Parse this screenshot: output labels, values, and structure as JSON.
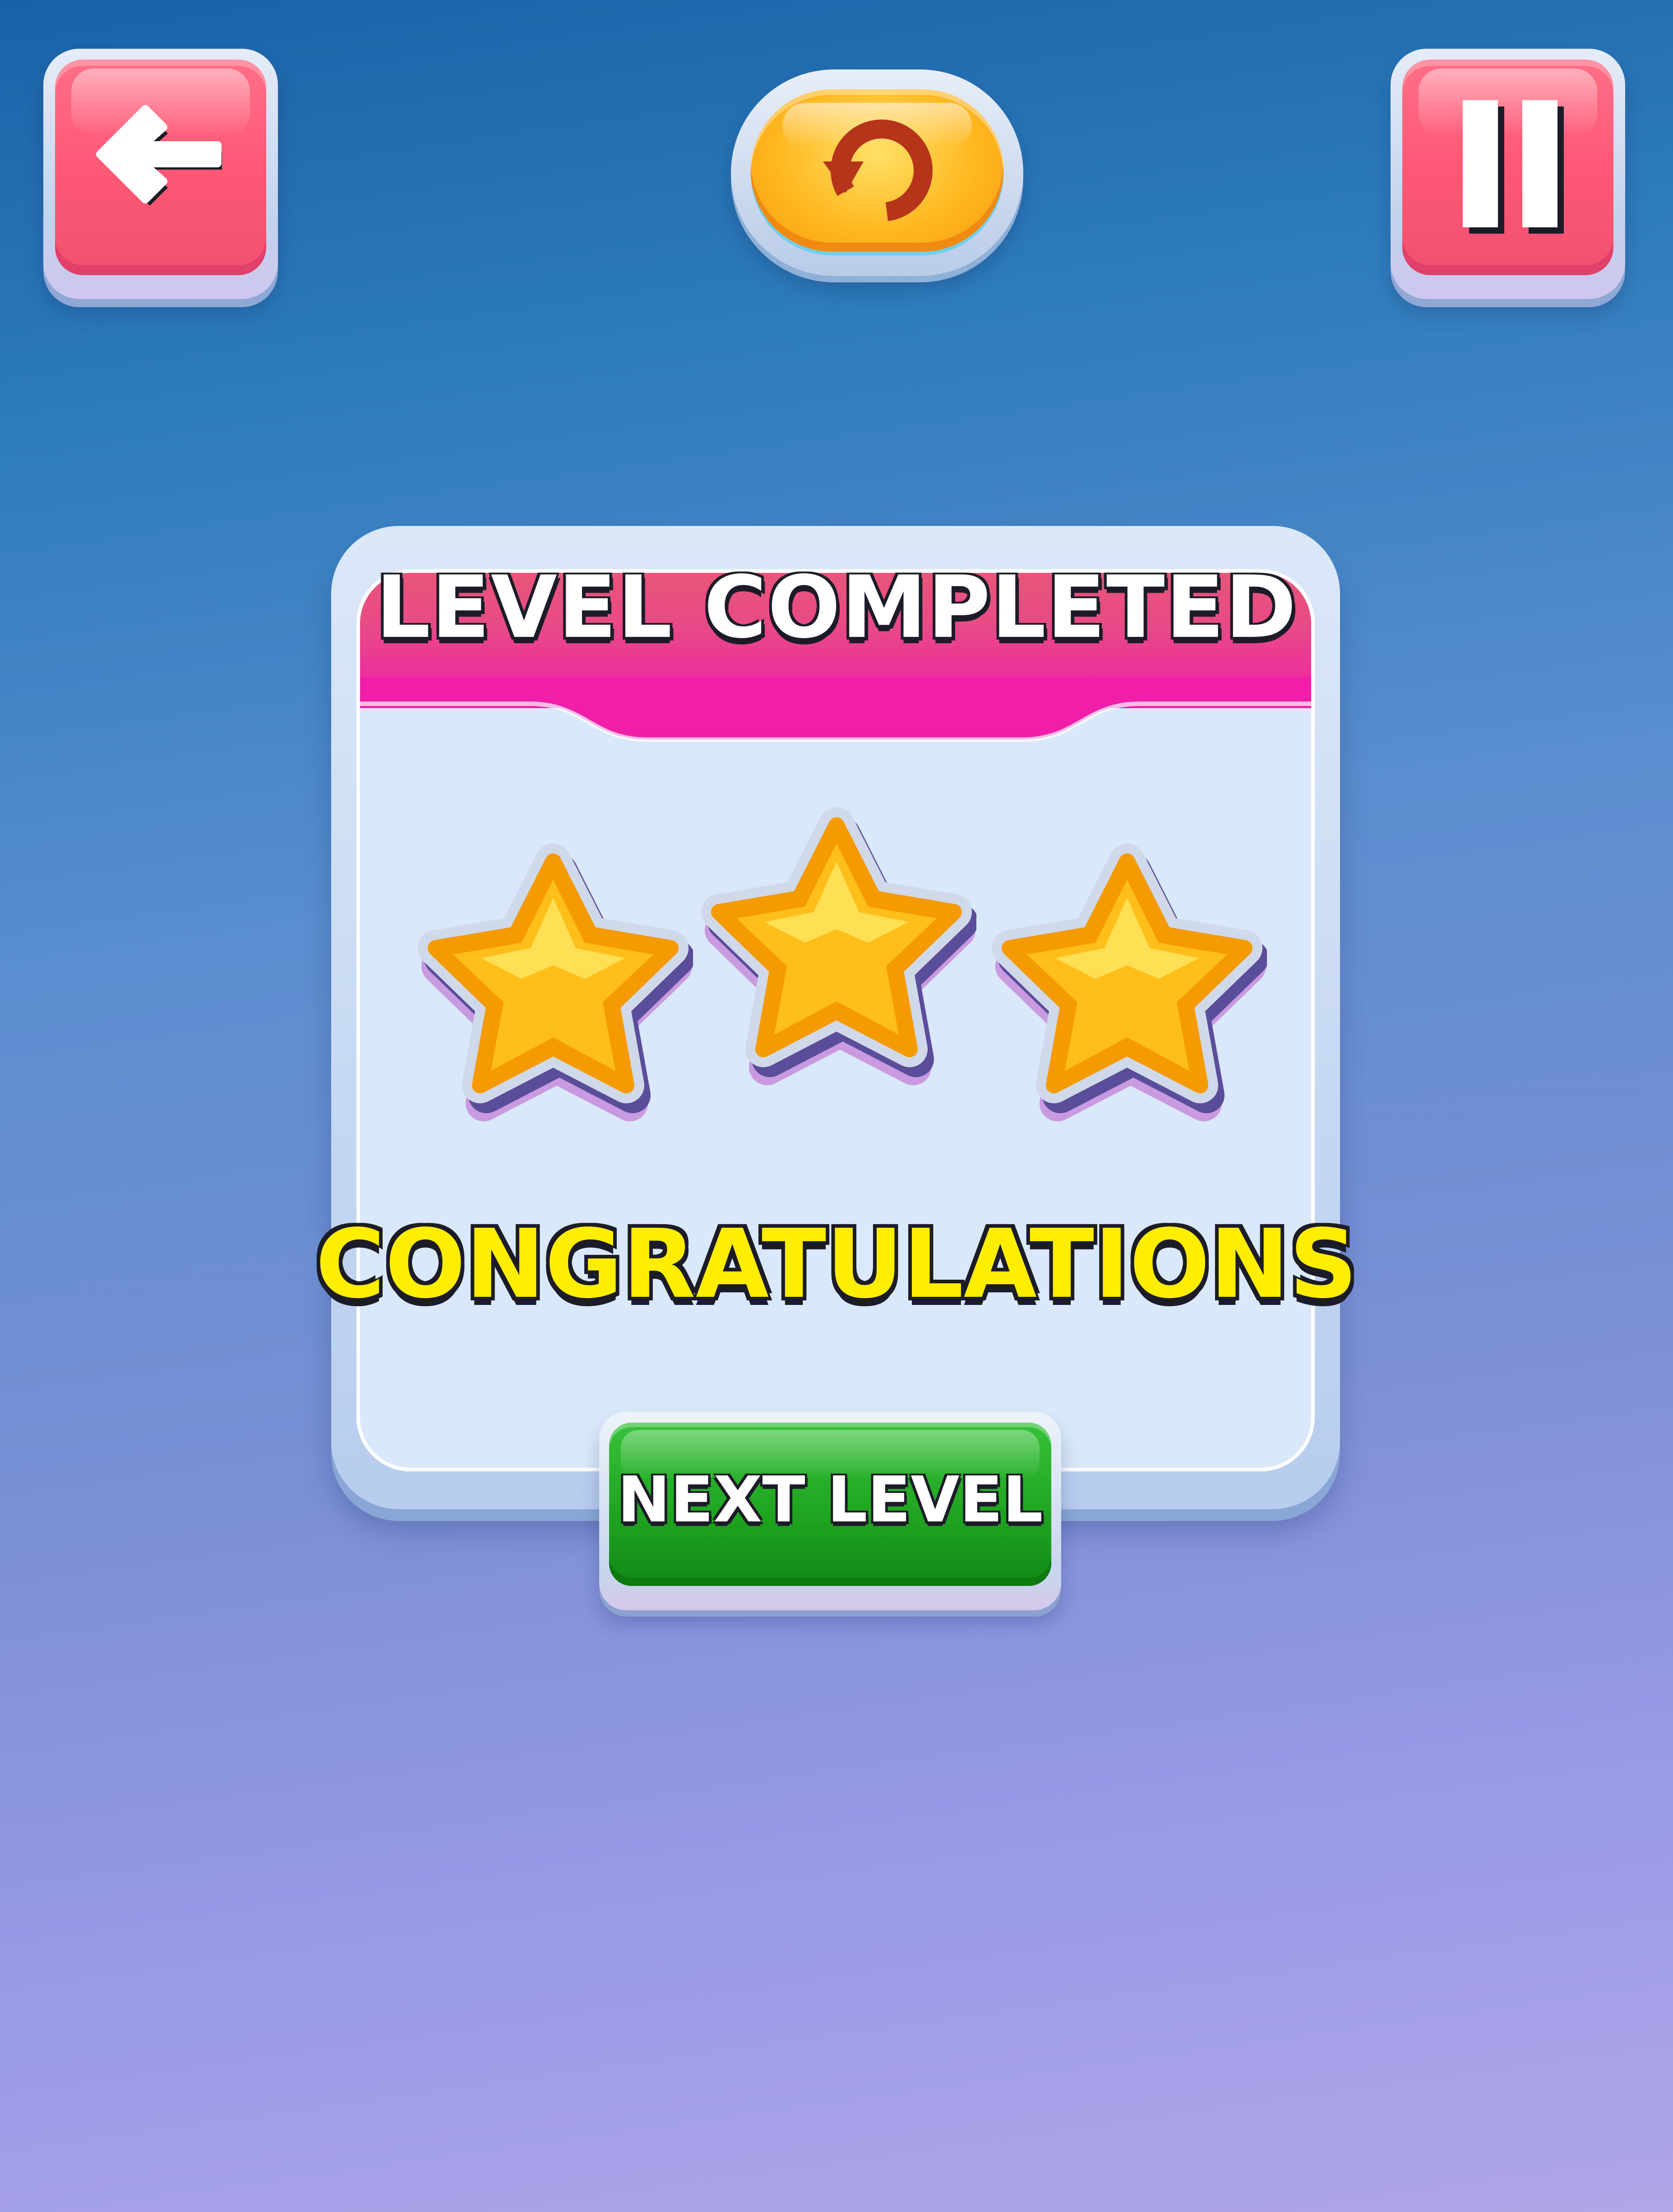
{
  "screen": {
    "title": "LEVEL COMPLETED",
    "message": "CONGRATULATIONS"
  },
  "top_bar": {
    "back_icon": "arrow-left-icon",
    "restart_icon": "restart-icon",
    "pause_icon": "pause-icon"
  },
  "rating": {
    "stars_earned": 3,
    "stars_total": 3
  },
  "next_button": {
    "label": "NEXT LEVEL"
  },
  "colors": {
    "header_pink": "#e8557a",
    "button_red": "#ff5a78",
    "button_yellow": "#ffb820",
    "button_green": "#1ea21f",
    "star_orange": "#ffa800",
    "message_yellow": "#ffee00"
  }
}
